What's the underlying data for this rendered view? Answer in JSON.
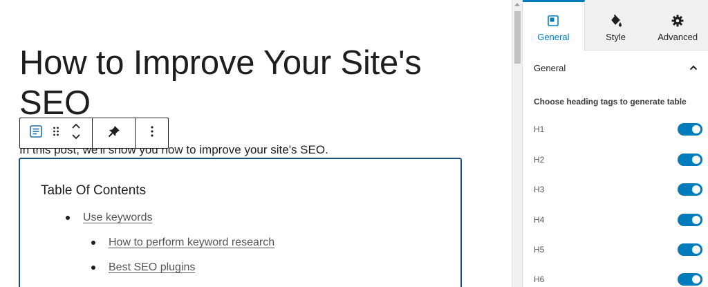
{
  "post": {
    "title": "How to Improve Your Site's SEO",
    "paragraph": "In this post, we'll show you how to improve your site's SEO."
  },
  "block_toolbar": {
    "icons": [
      "paragraph-block-icon",
      "drag-handle-icon",
      "move-up-down-icon",
      "pin-icon",
      "more-options-icon"
    ]
  },
  "toc": {
    "title": "Table Of Contents",
    "items": [
      {
        "label": "Use keywords",
        "level": 1
      },
      {
        "label": "How to perform keyword research",
        "level": 2
      },
      {
        "label": "Best SEO plugins",
        "level": 2
      }
    ],
    "border_color": "#1d4f7c"
  },
  "sidebar": {
    "tabs": [
      {
        "label": "General",
        "icon": "general-layout-icon",
        "active": true
      },
      {
        "label": "Style",
        "icon": "paint-bucket-icon",
        "active": false
      },
      {
        "label": "Advanced",
        "icon": "gear-icon",
        "active": false
      }
    ],
    "panel": {
      "title": "General",
      "expanded": true,
      "description": "Choose heading tags to generate table",
      "toggles": [
        {
          "label": "H1",
          "on": true
        },
        {
          "label": "H2",
          "on": true
        },
        {
          "label": "H3",
          "on": true
        },
        {
          "label": "H4",
          "on": true
        },
        {
          "label": "H5",
          "on": true
        },
        {
          "label": "H6",
          "on": true
        }
      ]
    },
    "accent_color": "#007cba"
  }
}
